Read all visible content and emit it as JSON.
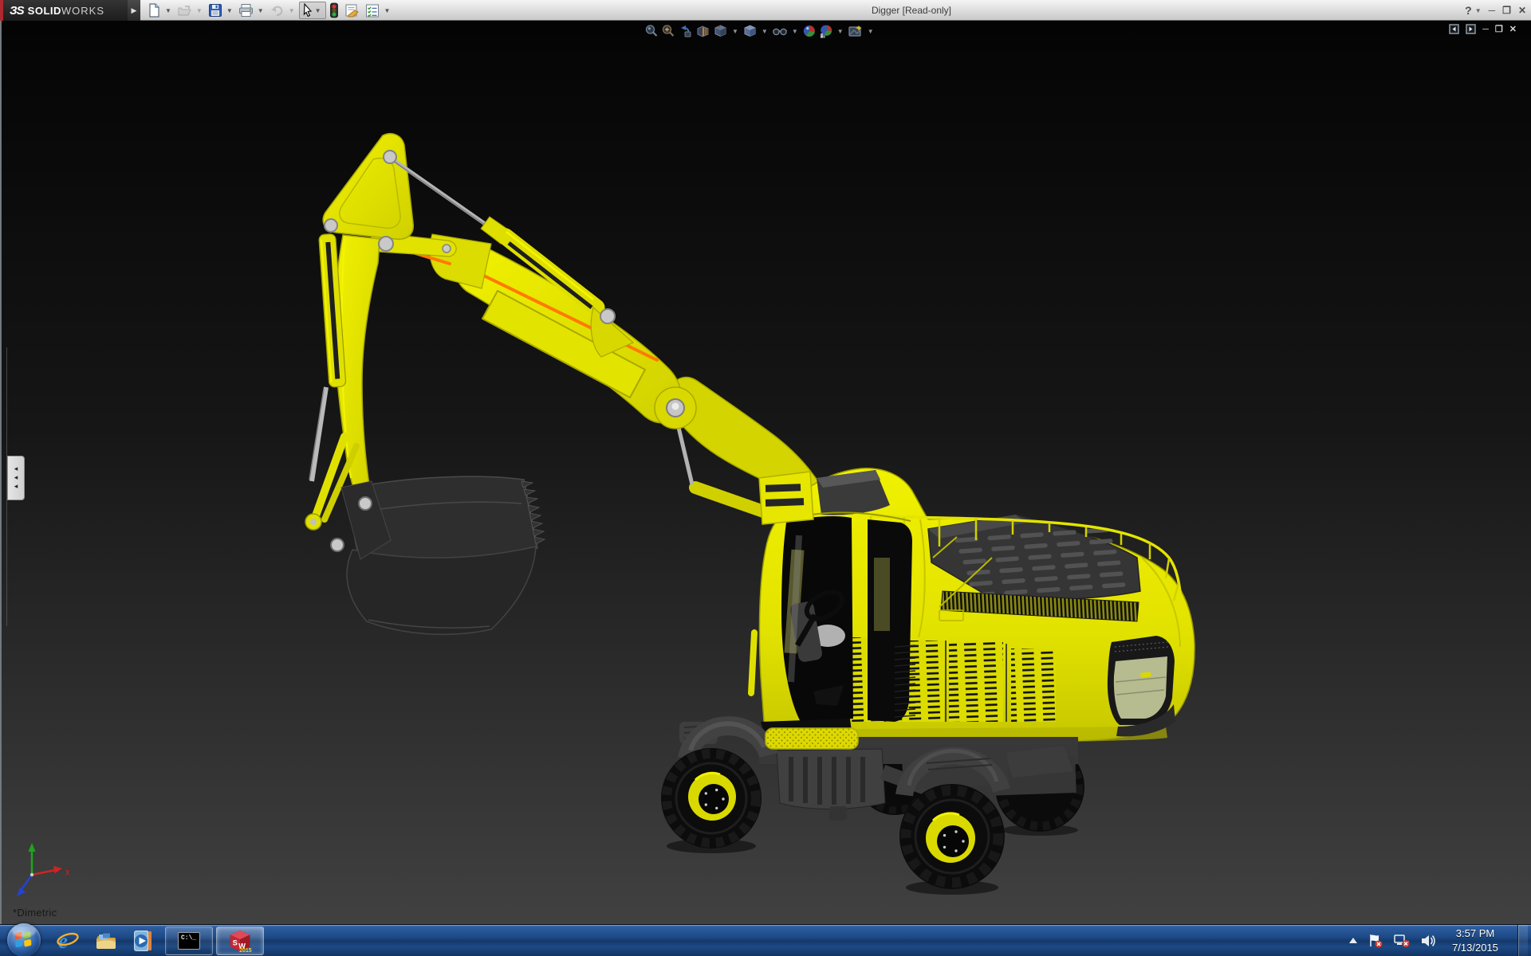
{
  "window": {
    "brand_mark": "ЗS",
    "brand_bold": "SOLID",
    "brand_light": "WORKS",
    "title": "Digger [Read-only]",
    "controls": [
      "help-icon",
      "minimize-button",
      "restore-button",
      "close-button"
    ]
  },
  "main_toolbar": {
    "items": [
      {
        "name": "new-document",
        "enabled": true,
        "dropdown": true
      },
      {
        "name": "open-document",
        "enabled": false,
        "dropdown": true
      },
      {
        "name": "save",
        "enabled": true,
        "dropdown": true
      },
      {
        "name": "print",
        "enabled": true,
        "dropdown": true
      },
      {
        "name": "undo",
        "enabled": false,
        "dropdown": true
      },
      {
        "name": "select",
        "enabled": true,
        "pressed": true,
        "dropdown": true
      },
      {
        "name": "rebuild-traffic-light",
        "enabled": true
      },
      {
        "name": "file-properties",
        "enabled": true
      },
      {
        "name": "options",
        "enabled": true,
        "dropdown": true
      }
    ]
  },
  "headsup_toolbar": {
    "items": [
      {
        "name": "zoom-to-fit"
      },
      {
        "name": "zoom-to-area"
      },
      {
        "name": "previous-view"
      },
      {
        "name": "section-view"
      },
      {
        "name": "view-orientation",
        "dropdown": true
      },
      {
        "name": "display-style",
        "dropdown": true
      },
      {
        "name": "hide-show-items",
        "dropdown": true
      },
      {
        "name": "edit-appearance"
      },
      {
        "name": "apply-scene",
        "dropdown": true
      },
      {
        "name": "view-settings",
        "dropdown": true
      }
    ]
  },
  "document_window": {
    "controls": [
      "pane-collapse-left",
      "pane-collapse-right",
      "minimize",
      "restore",
      "close"
    ]
  },
  "left_panel_tab": {
    "name": "collapsed-feature-manager",
    "glyph": "◂"
  },
  "viewport": {
    "view_orientation_label": "*Dimetric",
    "model_name": "Digger",
    "colors": {
      "body_yellow": "#e6e600",
      "accent_orange": "#ff7a00",
      "chassis_gray": "#3a3a3a",
      "bucket_gray": "#2e2e2e",
      "pin_gray": "#c8c8c8",
      "rod_silver": "#b5b5b5",
      "background_top": "#050505",
      "background_bottom": "#404040"
    },
    "triad": {
      "x_label": "x",
      "axes": [
        {
          "axis": "x",
          "color": "#cc2525"
        },
        {
          "axis": "y",
          "color": "#1da51d"
        },
        {
          "axis": "z",
          "color": "#2742cc"
        }
      ]
    }
  },
  "taskbar": {
    "start": "start-button",
    "pinned": [
      "internet-explorer",
      "windows-explorer",
      "media-player"
    ],
    "running": [
      {
        "name": "command-prompt",
        "label": "C:\\_",
        "active": false
      },
      {
        "name": "solidworks-2015",
        "label": "2015",
        "active": true
      }
    ],
    "tray": [
      "hidden-icons-arrow",
      "action-center-flag",
      "network-error",
      "volume"
    ],
    "clock": {
      "time": "3:57 PM",
      "date": "7/13/2015"
    }
  }
}
